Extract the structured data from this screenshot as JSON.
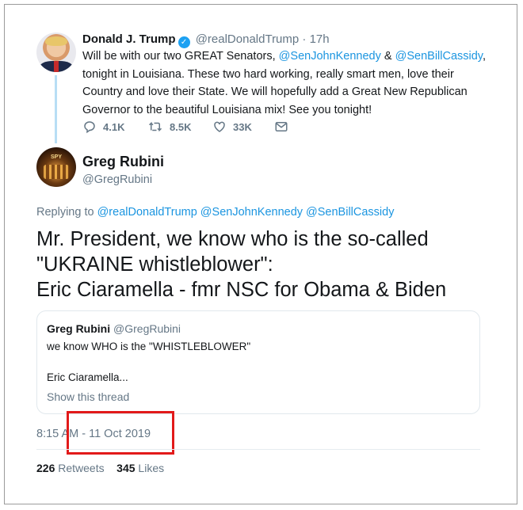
{
  "original_tweet": {
    "author_name": "Donald J. Trump",
    "verified_mark": "✓",
    "author_handle": "@realDonaldTrump",
    "separator": "·",
    "time_ago": "17h",
    "text_part1": "Will be with our two GREAT Senators, ",
    "mention1": "@SenJohnKennedy",
    "text_part2": " & ",
    "mention2": "@SenBillCassidy",
    "text_part3": ", tonight in Louisiana. These two hard working, really smart men, love their Country and love their State. We will hopefully add a Great New Republican Governor to the beautiful Louisiana mix! See you tonight!",
    "actions": {
      "reply_count": "4.1K",
      "retweet_count": "8.5K",
      "like_count": "33K"
    }
  },
  "reply_tweet": {
    "author_name": "Greg Rubini",
    "author_handle": "@GregRubini",
    "avatar_badge": "SPY",
    "replying_to_prefix": "Replying to ",
    "replying_to": "@realDonaldTrump @SenJohnKennedy @SenBillCassidy",
    "text_line1": "Mr. President, we know who is the so-called",
    "text_line2": "\"UKRAINE whistleblower\":",
    "text_line3": "Eric Ciaramella - fmr NSC for Obama & Biden",
    "quoted": {
      "author_name": "Greg Rubini",
      "author_handle": "@GregRubini",
      "line1": "we know WHO is the \"WHISTLEBLOWER\"",
      "line2": "Eric Ciaramella...",
      "show_thread": "Show this thread"
    },
    "timestamp": "8:15 AM - 11 Oct 2019",
    "retweets_count": "226",
    "retweets_label": "Retweets",
    "likes_count": "345",
    "likes_label": "Likes"
  },
  "colors": {
    "link": "#1b95e0",
    "muted": "#657786",
    "verified": "#1da1f2",
    "highlight_box": "#e21a1a"
  },
  "icons": [
    "reply-icon",
    "retweet-icon",
    "like-icon",
    "message-icon",
    "verified-icon"
  ]
}
